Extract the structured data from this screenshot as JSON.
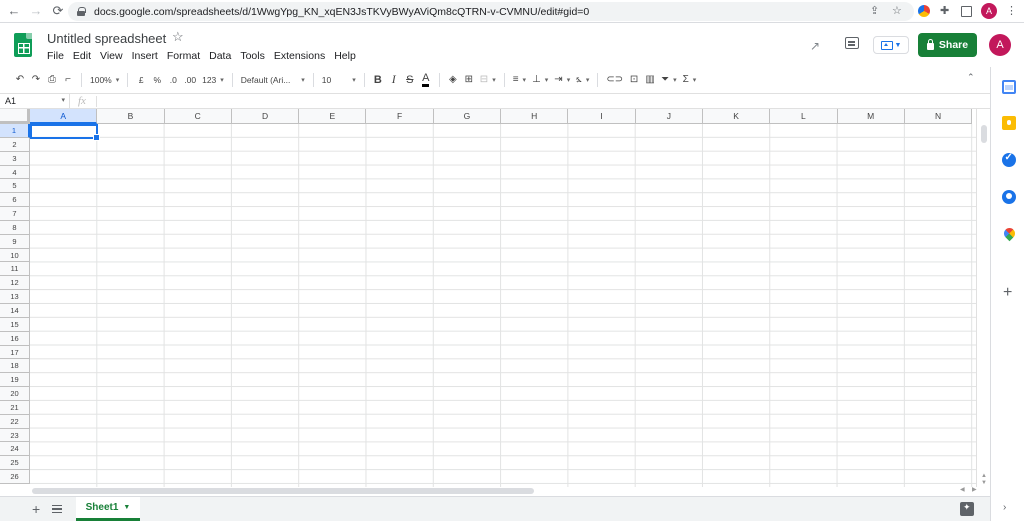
{
  "browser": {
    "url": "docs.google.com/spreadsheets/d/1WwgYpg_KN_xqEN3JsTKVyBWyAViQm8cQTRN-v-CVMNU/edit#gid=0",
    "avatar_initial": "A"
  },
  "doc": {
    "title": "Untitled spreadsheet",
    "avatar_initial": "A",
    "share_label": "Share",
    "menu": [
      "File",
      "Edit",
      "View",
      "Insert",
      "Format",
      "Data",
      "Tools",
      "Extensions",
      "Help"
    ]
  },
  "toolbar": {
    "zoom": "100%",
    "currency": "£",
    "percent": "%",
    "decrease_decimal": ".0",
    "increase_decimal": ".00",
    "more_formats": "123",
    "font": "Default (Ari...",
    "font_size": "10",
    "bold": "B",
    "italic": "I",
    "strike": "S",
    "text_color": "A",
    "functions": "Σ"
  },
  "formula_bar": {
    "cell_ref": "A1",
    "fx": "fx"
  },
  "grid": {
    "columns": [
      "A",
      "B",
      "C",
      "D",
      "E",
      "F",
      "G",
      "H",
      "I",
      "J",
      "K",
      "L",
      "M",
      "N"
    ],
    "rows": [
      "1",
      "2",
      "3",
      "4",
      "5",
      "6",
      "7",
      "8",
      "9",
      "10",
      "11",
      "12",
      "13",
      "14",
      "15",
      "16",
      "17",
      "18",
      "19",
      "20",
      "21",
      "22",
      "23",
      "24",
      "25",
      "26"
    ],
    "selected_cell": "A1"
  },
  "sheets": {
    "tabs": [
      {
        "label": "Sheet1",
        "active": true
      }
    ]
  },
  "colors": {
    "brand_green": "#188038",
    "selection_blue": "#1a73e8",
    "avatar": "#c2185b"
  }
}
